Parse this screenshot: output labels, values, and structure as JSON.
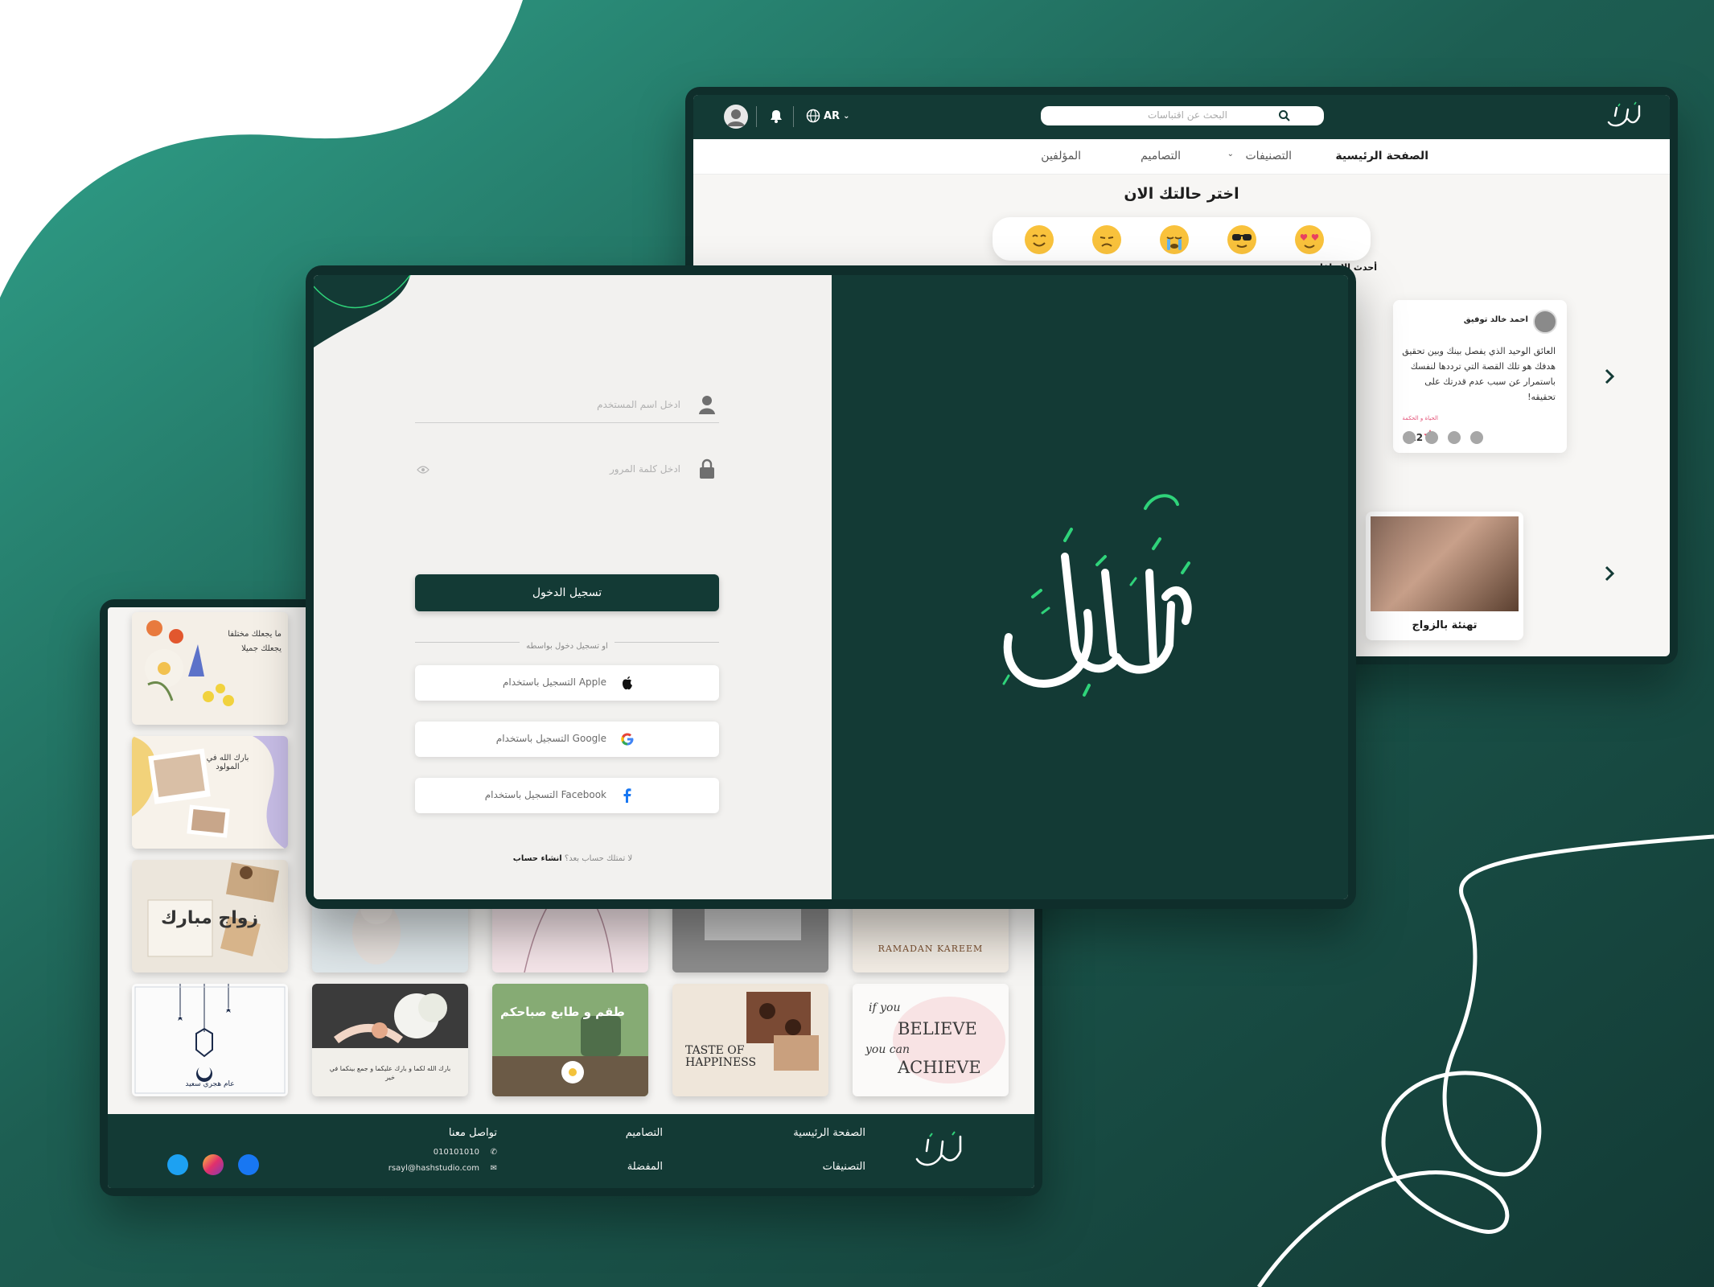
{
  "home": {
    "search_placeholder": "البحث عن اقتباسات",
    "language": "AR",
    "nav": [
      "الصفحة الرئيسية",
      "التصنيفات",
      "التصاميم",
      "المؤلفين"
    ],
    "mood_title": "اختر حالتك الان",
    "mood_label_active": "أحدث الإضافات",
    "quote": {
      "author": "احمد خالد توفيق",
      "text": "العائق الوحيد الذي يفصل بينك وبين تحقيق هدفك هو تلك القصة التي ترددها لنفسك باستمرار عن سبب عدم قدرتك على تحقيقه!",
      "tag": "الحياة و الحكمة",
      "likes": "112"
    },
    "design_caption": "تهنئة بالزواج"
  },
  "login": {
    "username_placeholder": "ادخل اسم المستخدم",
    "password_placeholder": "ادخل كلمة المرور",
    "login_button": "تسجيل الدخول",
    "divider": "او تسجيل دخول بواسطه",
    "apple": "التسجيل باستخدام  Apple",
    "google": "التسجيل باستخدام  Google",
    "facebook": "التسجيل باستخدام  Facebook",
    "no_account": "لا تمتلك حساب بعد؟",
    "create_account": "انشاء حساب"
  },
  "gallery": {
    "tile_flowers_1": "ما يجعلك مختلفا",
    "tile_flowers_2": "يجعلك جميلا",
    "tile_baby": "بارك الله في المولود",
    "tile_marriage": "زواج مبارك",
    "tile_ramadan": "RAMADAN KAREEM",
    "tile_hijri": "عام هجري سعيد",
    "tile_wedding": "بارك الله لكما و بارك عليكما و جمع بينكما في خير",
    "tile_morning": "طقم و طابع صباحكم",
    "tile_taste": "TASTE OF HAPPINESS",
    "tile_believe_1": "if you",
    "tile_believe_2": "BELIEVE",
    "tile_believe_3": "you can",
    "tile_believe_4": "ACHIEVE"
  },
  "footer": {
    "home": "الصفحة الرئيسية",
    "categories": "التصنيفات",
    "designs": "التصاميم",
    "favorites": "المفضلة",
    "contact": "تواصل معنا",
    "phone": "010101010",
    "email": "rsayl@hashstudio.com"
  },
  "colors": {
    "brand": "#133a35",
    "accent_green": "#2fd37a",
    "background_gradient": [
      "#2f9e8a",
      "#133a35"
    ]
  },
  "icons": [
    "user-icon",
    "lock-icon",
    "eye-icon",
    "apple-icon",
    "google-icon",
    "facebook-icon",
    "bell-icon",
    "globe-icon",
    "search-icon",
    "star-icon",
    "twitter-icon",
    "instagram-icon"
  ]
}
